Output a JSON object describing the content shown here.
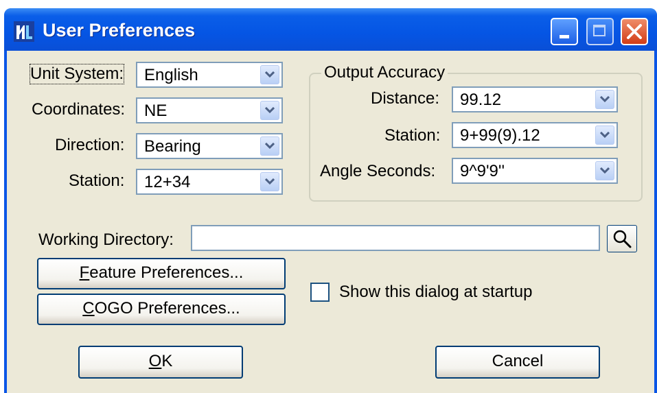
{
  "window": {
    "title": "User Preferences",
    "icon": "microstation-app-icon",
    "controls": {
      "minimize": "minimize-icon",
      "maximize": "maximize-icon",
      "close": "close-icon"
    }
  },
  "left_fields": [
    {
      "label": "Unit System:",
      "value": "English"
    },
    {
      "label": "Coordinates:",
      "value": "NE"
    },
    {
      "label": "Direction:",
      "value": "Bearing"
    },
    {
      "label": "Station:",
      "value": "12+34"
    }
  ],
  "output_accuracy": {
    "title": "Output Accuracy",
    "fields": [
      {
        "label": "Distance:",
        "value": "99.12"
      },
      {
        "label": "Station:",
        "value": "9+99(9).12"
      },
      {
        "label": "Angle Seconds:",
        "value": "9^9'9''"
      }
    ]
  },
  "working_directory": {
    "label": "Working Directory:",
    "value": "",
    "browse_icon": "search-icon"
  },
  "buttons": {
    "feature_prefix": "F",
    "feature_rest": "eature Preferences...",
    "cogo_prefix": "C",
    "cogo_rest": "OGO Preferences...",
    "ok_prefix": "O",
    "ok_rest": "K",
    "cancel": "Cancel"
  },
  "startup": {
    "label": "Show this dialog at startup",
    "checked": false
  },
  "colors": {
    "titlebar": "#0a55e6",
    "dialog_bg": "#ece9d8",
    "field_border": "#7f9db9",
    "close_button": "#d23c16"
  }
}
